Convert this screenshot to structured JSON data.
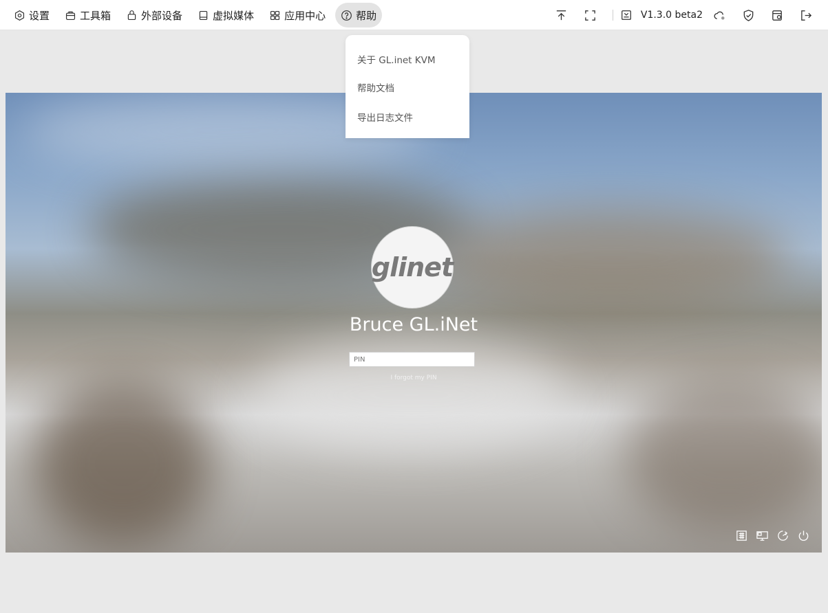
{
  "toolbar": {
    "menu": [
      {
        "label": "设置",
        "icon": "settings-icon"
      },
      {
        "label": "工具箱",
        "icon": "toolbox-icon"
      },
      {
        "label": "外部设备",
        "icon": "lock-device-icon"
      },
      {
        "label": "虚拟媒体",
        "icon": "drive-icon"
      },
      {
        "label": "应用中心",
        "icon": "apps-grid-icon"
      },
      {
        "label": "帮助",
        "icon": "help-circle-icon"
      }
    ],
    "version": "V1.3.0 beta2",
    "right_icons": [
      "upload-top-icon",
      "fullscreen-icon",
      "version-download-icon",
      "cloud-icon",
      "shield-check-icon",
      "window-switch-icon",
      "logout-icon"
    ]
  },
  "help_dropdown": {
    "items": [
      "关于 GL.inet KVM",
      "帮助文档",
      "导出日志文件"
    ]
  },
  "remote_screen": {
    "avatar_text": "glinet",
    "user_name": "Bruce GL.iNet",
    "pin_placeholder": "PIN",
    "forgot_pin": "I forgot my PIN",
    "corner_icons": [
      "keyboard-icon",
      "network-icon",
      "accessibility-icon",
      "power-icon"
    ]
  },
  "colors": {
    "toolbar_bg": "#ffffff",
    "page_bg": "#e9e9e9",
    "active_menu_bg": "#e3e3e3",
    "text": "#222222"
  }
}
